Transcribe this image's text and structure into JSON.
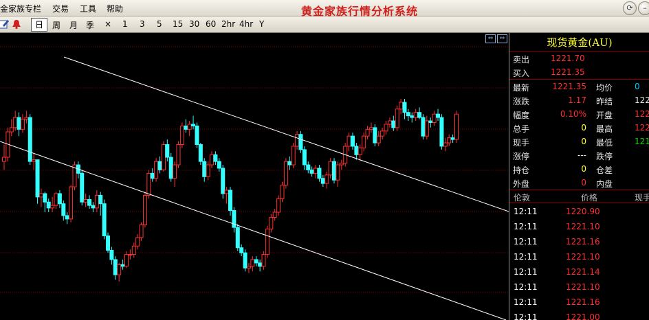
{
  "menu": {
    "items": [
      "金家族专栏",
      "交易",
      "工具",
      "帮助"
    ],
    "title": "黄金家族行情分析系统"
  },
  "window": {
    "icons": [
      "refresh-icon",
      "minimize-icon"
    ]
  },
  "toolbar": {
    "active": "日",
    "periods": [
      "周",
      "月",
      "季",
      "×",
      "1",
      "3",
      "5",
      "15",
      "30",
      "60",
      "2hr",
      "4hr",
      "Y"
    ]
  },
  "panel": {
    "title": "现货黄金(AU)",
    "sell_label": "卖出",
    "sell_value": "1221.70",
    "buy_label": "买入",
    "buy_value": "1221.35",
    "stats": [
      {
        "l1": "最新",
        "v1": "1221.35",
        "c1": "#ff3030",
        "l2": "均价",
        "v2": "0",
        "c2": "#00ccff"
      },
      {
        "l1": "涨跌",
        "v1": "1.17",
        "c1": "#ff3030",
        "l2": "昨结",
        "v2": "122",
        "c2": "#e6e6e6"
      },
      {
        "l1": "幅度",
        "v1": "0.10%",
        "c1": "#ff3030",
        "l2": "开盘",
        "v2": "122",
        "c2": "#ff3030"
      },
      {
        "l1": "总手",
        "v1": "0",
        "c1": "#ffff33",
        "l2": "最高",
        "v2": "122",
        "c2": "#ff3030"
      },
      {
        "l1": "现手",
        "v1": "0",
        "c1": "#ffff33",
        "l2": "最低",
        "v2": "121",
        "c2": "#00dd00"
      },
      {
        "l1": "涨停",
        "v1": "---",
        "c1": "#e6e6e6",
        "l2": "跌停",
        "v2": "",
        "c2": "#e6e6e6"
      },
      {
        "l1": "持仓",
        "v1": "0",
        "c1": "#ffff33",
        "l2": "仓差",
        "v2": "",
        "c2": "#e6e6e6"
      },
      {
        "l1": "外盘",
        "v1": "0",
        "c1": "#ff3030",
        "l2": "内盘",
        "v2": "",
        "c2": "#e6e6e6"
      }
    ],
    "trade_headers": [
      "伦敦",
      "价格",
      "现手"
    ],
    "trades": [
      {
        "time": "12:11",
        "price": "1220.90"
      },
      {
        "time": "12:11",
        "price": "1221.10"
      },
      {
        "time": "12:11",
        "price": "1221.16"
      },
      {
        "time": "12:11",
        "price": "1221.10"
      },
      {
        "time": "12:11",
        "price": "1221.14"
      },
      {
        "time": "12:11",
        "price": "1221.10"
      },
      {
        "time": "12:11",
        "price": "1221.16"
      },
      {
        "time": "12:11",
        "price": "1221.00"
      }
    ]
  },
  "colors": {
    "up": "#ff3030",
    "down": "#33ffff",
    "grid": "#8a0000",
    "trend": "#ffffff"
  },
  "chart_data": {
    "type": "candlestick",
    "trendlines": 2,
    "candles": [
      [
        300,
        305,
        320,
        290
      ],
      [
        305,
        335,
        340,
        300
      ],
      [
        335,
        340,
        350,
        330
      ],
      [
        340,
        352,
        360,
        336
      ],
      [
        352,
        338,
        358,
        330
      ],
      [
        338,
        350,
        356,
        334
      ],
      [
        350,
        352,
        360,
        345
      ],
      [
        352,
        300,
        356,
        296
      ],
      [
        300,
        302,
        310,
        290
      ],
      [
        302,
        258,
        262,
        250
      ],
      [
        258,
        262,
        268,
        246
      ],
      [
        262,
        252,
        264,
        240
      ],
      [
        252,
        245,
        256,
        240
      ],
      [
        245,
        248,
        258,
        240
      ],
      [
        248,
        262,
        264,
        244
      ],
      [
        262,
        250,
        266,
        245
      ],
      [
        250,
        236,
        254,
        230
      ],
      [
        236,
        232,
        240,
        226
      ],
      [
        232,
        270,
        272,
        228
      ],
      [
        270,
        296,
        300,
        266
      ],
      [
        296,
        286,
        300,
        280
      ],
      [
        286,
        252,
        290,
        248
      ],
      [
        252,
        255,
        262,
        246
      ],
      [
        255,
        248,
        260,
        244
      ],
      [
        248,
        245,
        252,
        240
      ],
      [
        245,
        260,
        266,
        240
      ],
      [
        260,
        250,
        264,
        236
      ],
      [
        250,
        212,
        255,
        208
      ],
      [
        212,
        195,
        216,
        192
      ],
      [
        195,
        184,
        199,
        178
      ],
      [
        184,
        166,
        188,
        160
      ],
      [
        166,
        178,
        180,
        158
      ],
      [
        178,
        176,
        184,
        172
      ],
      [
        176,
        190,
        194,
        174
      ],
      [
        190,
        190,
        196,
        184
      ],
      [
        190,
        200,
        204,
        186
      ],
      [
        200,
        210,
        214,
        196
      ],
      [
        210,
        225,
        228,
        206
      ],
      [
        225,
        260,
        264,
        222
      ],
      [
        260,
        286,
        290,
        256
      ],
      [
        286,
        280,
        292,
        276
      ],
      [
        280,
        300,
        304,
        276
      ],
      [
        300,
        290,
        306,
        286
      ],
      [
        290,
        320,
        324,
        288
      ],
      [
        320,
        305,
        326,
        300
      ],
      [
        305,
        280,
        310,
        276
      ],
      [
        280,
        296,
        300,
        270
      ],
      [
        296,
        320,
        324,
        292
      ],
      [
        320,
        342,
        346,
        316
      ],
      [
        342,
        338,
        350,
        334
      ],
      [
        338,
        344,
        348,
        330
      ],
      [
        344,
        342,
        354,
        338
      ],
      [
        342,
        320,
        346,
        316
      ],
      [
        320,
        300,
        322,
        296
      ],
      [
        300,
        282,
        304,
        276
      ],
      [
        282,
        296,
        300,
        278
      ],
      [
        296,
        308,
        312,
        292
      ],
      [
        308,
        300,
        312,
        296
      ],
      [
        300,
        292,
        304,
        288
      ],
      [
        292,
        262,
        296,
        256
      ],
      [
        262,
        266,
        270,
        250
      ],
      [
        266,
        242,
        270,
        236
      ],
      [
        242,
        222,
        246,
        216
      ],
      [
        222,
        198,
        226,
        194
      ],
      [
        198,
        192,
        202,
        188
      ],
      [
        192,
        174,
        196,
        170
      ],
      [
        174,
        176,
        180,
        168
      ],
      [
        176,
        184,
        188,
        170
      ],
      [
        184,
        180,
        188,
        176
      ],
      [
        180,
        176,
        184,
        170
      ],
      [
        176,
        190,
        194,
        172
      ],
      [
        190,
        220,
        224,
        186
      ],
      [
        220,
        234,
        238,
        216
      ],
      [
        234,
        240,
        244,
        230
      ],
      [
        240,
        256,
        260,
        236
      ],
      [
        256,
        272,
        276,
        252
      ],
      [
        272,
        300,
        304,
        268
      ],
      [
        300,
        296,
        306,
        290
      ],
      [
        296,
        318,
        322,
        292
      ],
      [
        318,
        332,
        336,
        314
      ],
      [
        332,
        314,
        336,
        310
      ],
      [
        314,
        296,
        318,
        290
      ],
      [
        296,
        290,
        300,
        286
      ],
      [
        290,
        286,
        294,
        282
      ],
      [
        286,
        292,
        296,
        280
      ],
      [
        292,
        280,
        296,
        276
      ],
      [
        280,
        274,
        284,
        270
      ],
      [
        274,
        284,
        288,
        268
      ],
      [
        284,
        300,
        304,
        280
      ],
      [
        300,
        278,
        304,
        274
      ],
      [
        278,
        296,
        300,
        270
      ],
      [
        296,
        298,
        302,
        290
      ],
      [
        298,
        318,
        322,
        294
      ],
      [
        318,
        330,
        334,
        312
      ],
      [
        330,
        318,
        334,
        314
      ],
      [
        318,
        308,
        322,
        302
      ],
      [
        308,
        316,
        320,
        300
      ],
      [
        316,
        330,
        334,
        312
      ],
      [
        330,
        338,
        342,
        326
      ],
      [
        338,
        340,
        346,
        334
      ],
      [
        340,
        322,
        344,
        318
      ],
      [
        322,
        330,
        336,
        318
      ],
      [
        330,
        336,
        340,
        326
      ],
      [
        336,
        344,
        348,
        332
      ],
      [
        344,
        348,
        352,
        340
      ],
      [
        348,
        340,
        354,
        336
      ],
      [
        340,
        362,
        366,
        336
      ],
      [
        362,
        370,
        374,
        356
      ],
      [
        370,
        358,
        374,
        350
      ],
      [
        358,
        354,
        362,
        348
      ],
      [
        354,
        352,
        358,
        346
      ],
      [
        352,
        358,
        362,
        348
      ],
      [
        358,
        352,
        364,
        350
      ],
      [
        352,
        330,
        356,
        326
      ],
      [
        330,
        348,
        354,
        326
      ],
      [
        348,
        346,
        352,
        340
      ],
      [
        346,
        356,
        360,
        342
      ],
      [
        356,
        352,
        362,
        348
      ],
      [
        352,
        318,
        356,
        314
      ],
      [
        318,
        322,
        328,
        312
      ],
      [
        322,
        328,
        332,
        318
      ],
      [
        328,
        326,
        332,
        322
      ],
      [
        326,
        356,
        360,
        322
      ]
    ]
  }
}
